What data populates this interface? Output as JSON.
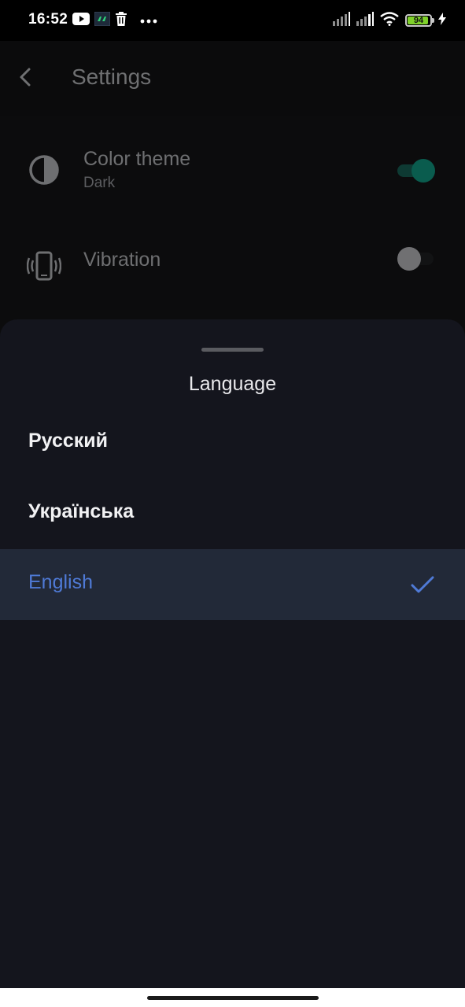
{
  "status_bar": {
    "time": "16:52",
    "battery_level": "94",
    "icons_left": [
      "youtube-icon",
      "app-notification-icon",
      "trash-icon",
      "more-dots-icon"
    ],
    "icons_right": [
      "signal-icon",
      "signal-icon",
      "wifi-icon",
      "battery-icon",
      "charging-icon"
    ]
  },
  "app_bar": {
    "title": "Settings",
    "back_icon": "chevron-left-icon"
  },
  "settings": {
    "color_theme": {
      "title": "Color theme",
      "value": "Dark",
      "icon": "contrast-icon",
      "enabled": true
    },
    "vibration": {
      "title": "Vibration",
      "icon": "vibration-icon",
      "enabled": false
    }
  },
  "language_sheet": {
    "title": "Language",
    "options": [
      {
        "label": "Русский",
        "selected": false
      },
      {
        "label": "Українська",
        "selected": false
      },
      {
        "label": "English",
        "selected": true
      }
    ],
    "selected_icon": "checkmark-icon"
  },
  "colors": {
    "accent_blue": "#4f7ad6",
    "toggle_on": "#0a5c4e",
    "sheet_background": "#14151d",
    "selected_row_background": "#222938",
    "battery_green": "#7fd12a"
  }
}
